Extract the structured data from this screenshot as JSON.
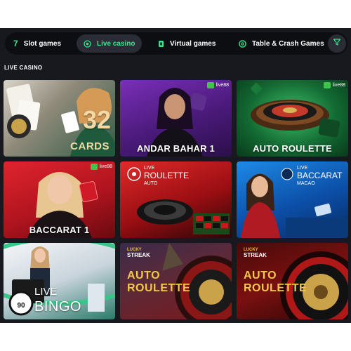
{
  "nav": {
    "items": [
      {
        "label": "Slot games",
        "icon": "seven-icon"
      },
      {
        "label": "Live casino",
        "icon": "live-dot-icon",
        "active": true
      },
      {
        "label": "Virtual games",
        "icon": "card-icon"
      },
      {
        "label": "Table & Crash Games",
        "icon": "chip-icon"
      }
    ],
    "filter_icon": "filter-icon"
  },
  "section": {
    "title": "LIVE CASINO"
  },
  "colors": {
    "accent": "#39e58c",
    "background": "#17191f",
    "nav_bg": "#0c0e12",
    "gold": "#f2c84a"
  },
  "games": [
    {
      "title": "",
      "big_text": "32",
      "sub_text": "CARDS"
    },
    {
      "title": "ANDAR BAHAR 1",
      "provider": "live88"
    },
    {
      "title": "AUTO ROULETTE",
      "provider": "live88"
    },
    {
      "title": "BACCARAT 1",
      "provider": "live88"
    },
    {
      "title": "",
      "brand_top": "LIVE",
      "brand_main": "ROULETTE",
      "brand_sub": "AUTO"
    },
    {
      "title": "",
      "brand_top": "LIVE",
      "brand_main": "BACCARAT",
      "brand_sub": "MACAO"
    },
    {
      "title": "",
      "brand_top": "LIVE",
      "brand_main": "BINGO",
      "ball": "90"
    },
    {
      "title": "",
      "streak_top": "LUCKY",
      "streak": "STREAK",
      "gold_line1": "AUTO",
      "gold_line2": "ROULETTE"
    },
    {
      "title": "",
      "streak_top": "LUCKY",
      "streak": "STREAK",
      "gold_line1": "AUTO",
      "gold_line2": "ROULETTE"
    }
  ]
}
